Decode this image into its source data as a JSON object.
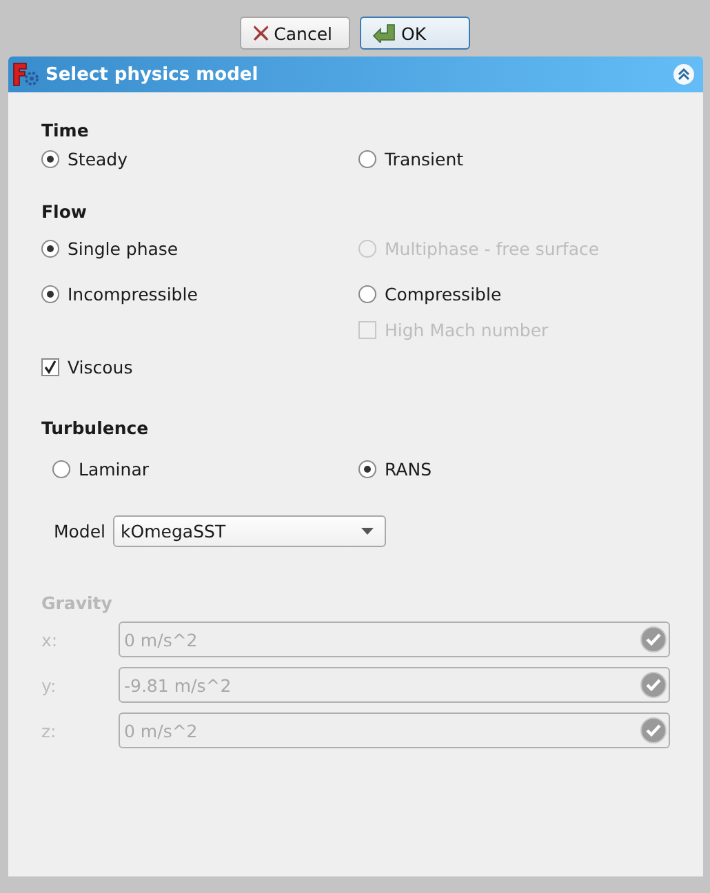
{
  "buttons": [
    {
      "label": "Cancel",
      "kind": "cancel"
    },
    {
      "label": "OK",
      "kind": "ok"
    }
  ],
  "panel": {
    "title": "Select physics model"
  },
  "time": {
    "heading": "Time",
    "options": [
      {
        "label": "Steady",
        "selected": true,
        "disabled": false
      },
      {
        "label": "Transient",
        "selected": false,
        "disabled": false
      }
    ]
  },
  "flow": {
    "heading": "Flow",
    "phase_options": [
      {
        "label": "Single phase",
        "selected": true,
        "disabled": false
      },
      {
        "label": "Multiphase - free surface",
        "selected": false,
        "disabled": true
      }
    ],
    "compressibility_options": [
      {
        "label": "Incompressible",
        "selected": true,
        "disabled": false
      },
      {
        "label": "Compressible",
        "selected": false,
        "disabled": false
      }
    ],
    "high_mach": {
      "label": "High Mach number",
      "checked": false,
      "disabled": true
    },
    "viscous": {
      "label": "Viscous",
      "checked": true,
      "disabled": false
    }
  },
  "turbulence": {
    "heading": "Turbulence",
    "options": [
      {
        "label": "Laminar",
        "selected": false,
        "disabled": false
      },
      {
        "label": "RANS",
        "selected": true,
        "disabled": false
      }
    ],
    "model": {
      "label": "Model",
      "value": "kOmegaSST"
    }
  },
  "gravity": {
    "heading": "Gravity",
    "disabled": true,
    "fields": [
      {
        "label": "x:",
        "value": "0 m/s^2"
      },
      {
        "label": "y:",
        "value": "-9.81 m/s^2"
      },
      {
        "label": "z:",
        "value": "0 m/s^2"
      }
    ]
  }
}
